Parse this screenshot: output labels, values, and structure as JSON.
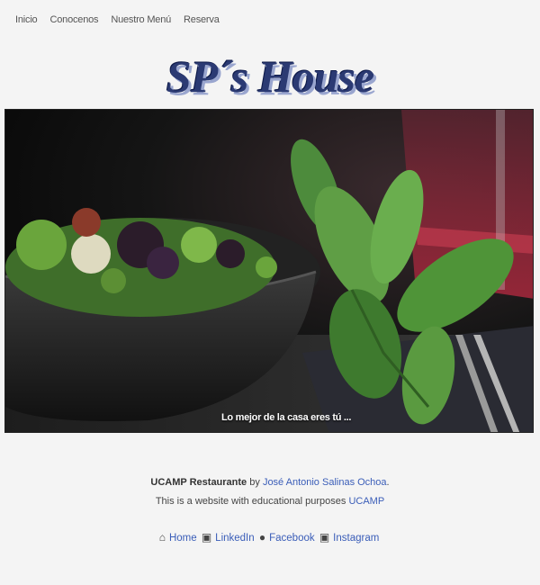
{
  "nav": [
    "Inicio",
    "Conocenos",
    "Nuestro Menú",
    "Reserva"
  ],
  "brand": "SP´s House",
  "hero": {
    "caption": "Lo mejor de la casa eres tú ..."
  },
  "footer": {
    "company": "UCAMP Restaurante",
    "by": "by",
    "author": "José Antonio Salinas Ochoa",
    "purpose_text": "This is a website with educational purposes",
    "purpose_link": "UCAMP",
    "links": [
      {
        "icon": "home-icon",
        "label": "Home"
      },
      {
        "icon": "linkedin-icon",
        "label": "LinkedIn"
      },
      {
        "icon": "facebook-icon",
        "label": "Facebook"
      },
      {
        "icon": "instagram-icon",
        "label": "Instagram"
      }
    ]
  }
}
